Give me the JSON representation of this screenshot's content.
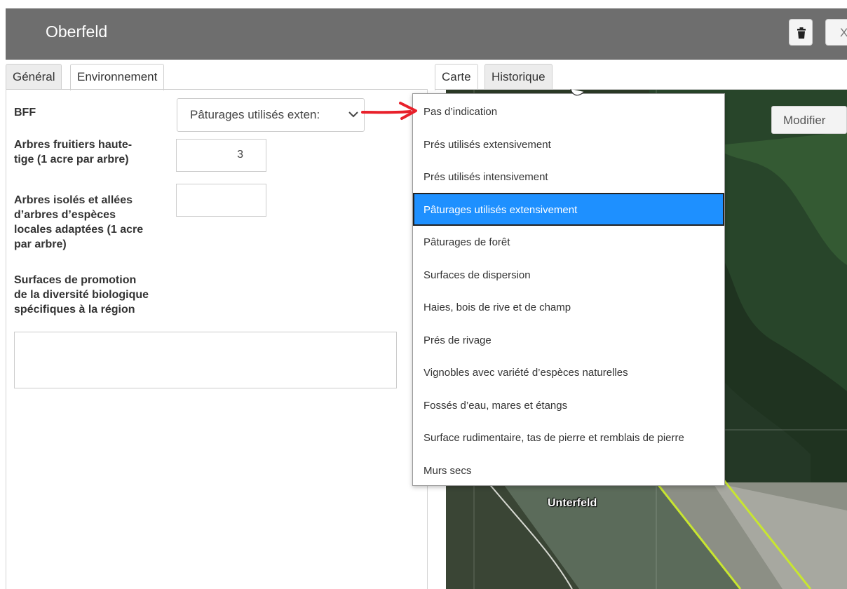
{
  "window": {
    "title": "Oberfeld",
    "close_label": "X"
  },
  "tabs_left": [
    {
      "label": "Général"
    },
    {
      "label": "Environnement"
    }
  ],
  "tabs_right": [
    {
      "label": "Carte"
    },
    {
      "label": "Historique"
    }
  ],
  "form": {
    "bff_label": "BFF",
    "bff_value": "Pâturages utilisés exten:",
    "fruit_label_1": "Arbres fruitiers haute-",
    "fruit_label_2": "tige (1 acre par arbre)",
    "fruit_value": "3",
    "isolated_label_1": "Arbres isolés et allées",
    "isolated_label_2": "d’arbres d’espèces",
    "isolated_label_3": "locales adaptées (1 acre",
    "isolated_label_4": "par arbre)",
    "isolated_value": "",
    "promo_label_1": "Surfaces de promotion",
    "promo_label_2": "de la diversité biologique",
    "promo_label_3": "spécifiques à la région",
    "promo_value": ""
  },
  "map": {
    "modify_label": "Modifier",
    "place_label": "Unterfeld"
  },
  "dropdown": {
    "selected_index": 3,
    "options": [
      "Pas d’indication",
      "Prés utilisés extensivement",
      "Prés utilisés intensivement",
      "Pâturages utilisés extensivement",
      "Pâturages de forêt",
      "Surfaces de dispersion",
      "Haies, bois de rive et de champ",
      "Prés de rivage",
      "Vignobles avec variété d’espèces naturelles",
      "Fossés d’eau, mares et étangs",
      "Surface rudimentaire, tas de pierre et remblais de pierre",
      "Murs secs"
    ]
  },
  "colors": {
    "titlebar": "#6e6e6e",
    "selection": "#1e90ff",
    "annotation_arrow": "#e8202a",
    "map_field_border": "#c8e630"
  },
  "icons": {
    "delete": "trash-icon",
    "select": "chevron-down-icon",
    "annotation": "red-arrow-icon",
    "pointer": "mouse-cursor-icon"
  }
}
